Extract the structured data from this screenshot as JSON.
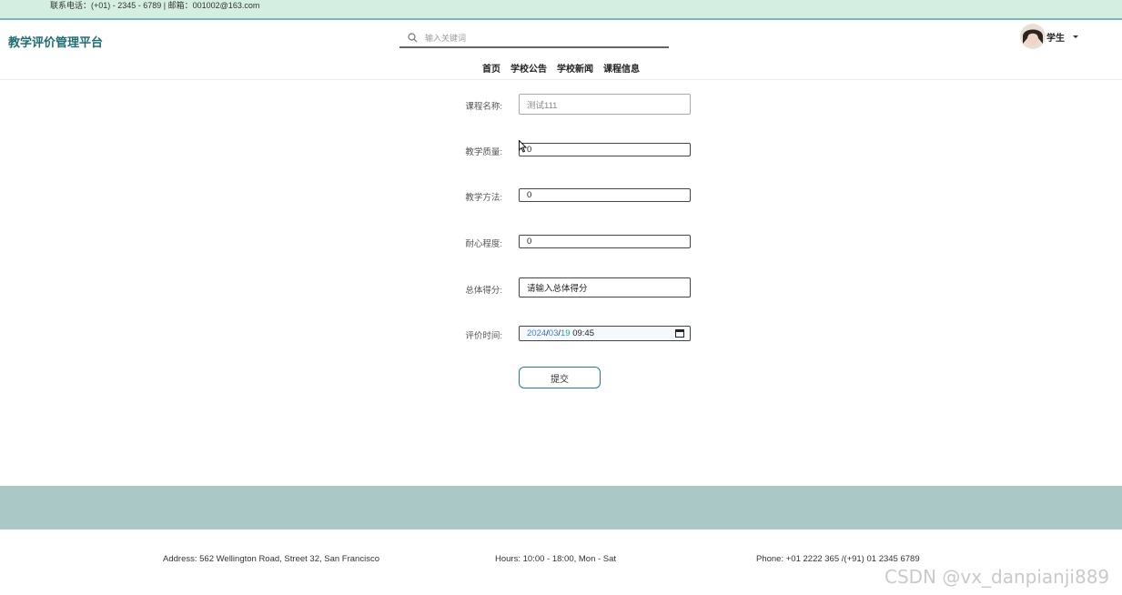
{
  "topbar": {
    "contact": "联系电话：(+01) - 2345 - 6789 | 邮箱：001002@163.com"
  },
  "header": {
    "brand": "教学评价管理平台",
    "search_placeholder": "输入关键词",
    "user_name": "学生",
    "nav": [
      "首页",
      "学校公告",
      "学校新闻",
      "课程信息"
    ]
  },
  "form": {
    "course_name": {
      "label": "课程名称:",
      "value": "测试111"
    },
    "teaching_quality": {
      "label": "教学质量:",
      "value": "0"
    },
    "teaching_method": {
      "label": "教学方法:",
      "value": "0"
    },
    "patience": {
      "label": "耐心程度:",
      "value": "0"
    },
    "total_score": {
      "label": "总体得分:",
      "value": "请输入总体得分"
    },
    "eval_time": {
      "label": "评价时间:",
      "year": "2024",
      "month": "03",
      "day": "19",
      "sep": "/",
      "time": "09:45"
    },
    "submit_label": "提交"
  },
  "footer": {
    "address": "Address: 562 Wellington Road, Street 32, San Francisco",
    "hours": "Hours: 10:00 - 18:00, Mon - Sat",
    "phone": "Phone: +01 2222 365 /(+91) 01 2345 6789"
  },
  "watermark": "CSDN @vx_danpianji889",
  "colors": {
    "brand": "#1f6d74",
    "topbar_bg": "#d4efe1",
    "band_bg": "#aac8c5",
    "accent_border": "#2b7a94"
  }
}
